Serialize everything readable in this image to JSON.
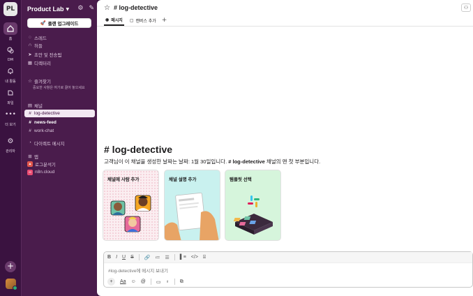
{
  "workspace": {
    "name": "Product Lab",
    "avatar_text": "PL"
  },
  "rail": {
    "items": [
      {
        "key": "home",
        "label": "홈"
      },
      {
        "key": "dm",
        "label": "DM"
      },
      {
        "key": "activity",
        "label": "내 활동"
      },
      {
        "key": "files",
        "label": "파일"
      },
      {
        "key": "more",
        "label": "더 보기"
      },
      {
        "key": "admin",
        "label": "관리자"
      }
    ]
  },
  "sidebar": {
    "upgrade_label": "플랜 업그레이드",
    "nav": [
      {
        "label": "스레드",
        "icon": "threads-icon"
      },
      {
        "label": "허들",
        "icon": "headphones-icon"
      },
      {
        "label": "초안 및 전송됨",
        "icon": "send-icon"
      },
      {
        "label": "디렉터리",
        "icon": "directory-icon"
      }
    ],
    "favorites": {
      "label": "즐겨찾기",
      "note": "중요한 사항은 여기로 끌어 놓으세요"
    },
    "channels": {
      "label": "채널",
      "items": [
        {
          "name": "log-detective",
          "active": true
        },
        {
          "name": "news-feed",
          "bold": true
        },
        {
          "name": "work-chat"
        }
      ]
    },
    "dm_label": "다이렉트 메시지",
    "apps": {
      "label": "앱",
      "items": [
        {
          "name": "로그분석기",
          "badge_color": "#e2574c"
        },
        {
          "name": "n8n.cloud",
          "badge_color": "#ea4b71"
        }
      ]
    }
  },
  "channel": {
    "title": "# log-detective",
    "tabs": [
      {
        "label": "메시지",
        "active": true
      },
      {
        "label": "캔버스 추가",
        "active": false
      }
    ],
    "intro_title": "# log-detective",
    "intro_desc_prefix": "고객님이 이 채널을 생성한 날짜는 날짜: 1월 30일입니다. ",
    "intro_desc_channel": "# log-detective",
    "intro_desc_suffix": " 채널의 맨 첫 부분입니다.",
    "cards": [
      {
        "title": "채널에 사람 추가",
        "color": "#fbeef1"
      },
      {
        "title": "채널 설명 추가",
        "color": "#c9f1ef"
      },
      {
        "title": "템플릿 선택",
        "color": "#d6f5dc"
      }
    ]
  },
  "composer": {
    "placeholder": "#log-detective에 메시지 보내기",
    "format_buttons": [
      "B",
      "I",
      "U",
      "S"
    ],
    "aa_label": "Aa"
  }
}
